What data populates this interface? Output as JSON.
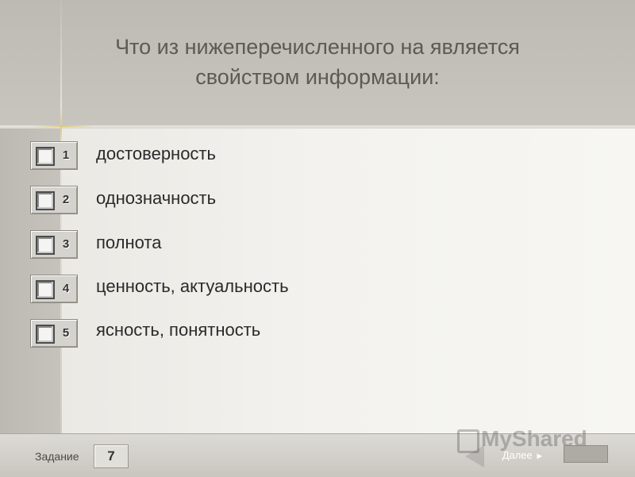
{
  "question": {
    "line1": "Что из нижеперечисленного на является",
    "line2": "свойством информации:"
  },
  "options": [
    {
      "num": "1",
      "label": "достоверность"
    },
    {
      "num": "2",
      "label": "однозначность"
    },
    {
      "num": "3",
      "label": "полнота"
    },
    {
      "num": "4",
      "label": "ценность, актуальность"
    },
    {
      "num": "5",
      "label": "ясность, понятность"
    }
  ],
  "footer": {
    "task_label": "Задание",
    "task_number": "7",
    "next_label": "Далее",
    "next_arrow": "►"
  },
  "watermark": {
    "text": "MyShared"
  },
  "colors": {
    "question_text": "#5e5a52",
    "option_text": "#2a2a2a",
    "content_bg": "#f3f2ee",
    "header_bg": "#c3c0ba"
  }
}
